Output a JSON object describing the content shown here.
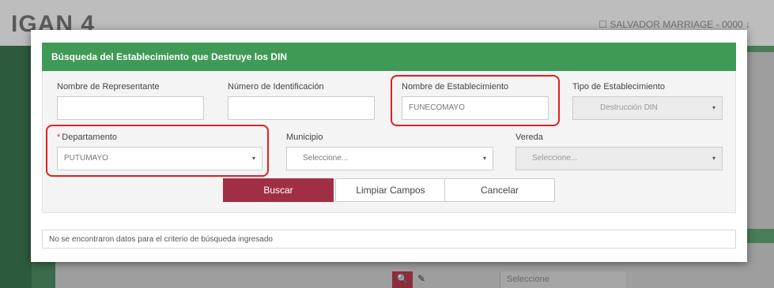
{
  "background": {
    "app_title": "IGAN 4",
    "user_text": "☐ SALVADOR MARRIAGE - 0000 ↓",
    "bottom_select_value": "Seleccione"
  },
  "modal": {
    "title": "Búsqueda del Establecimiento que Destruye los DIN",
    "fields": {
      "nombre_representante": {
        "label": "Nombre de Representante",
        "value": ""
      },
      "numero_identificacion": {
        "label": "Número de Identificación",
        "value": ""
      },
      "nombre_establecimiento": {
        "label": "Nombre de Establecimiento",
        "value": "FUNECOMAYO"
      },
      "tipo_establecimiento": {
        "label": "Tipo de Establecimiento",
        "value": "Destrucción DIN"
      },
      "departamento": {
        "label": "Departamento",
        "required_mark": "*",
        "value": "PUTUMAYO"
      },
      "municipio": {
        "label": "Municipio",
        "value": "Seleccione..."
      },
      "vereda": {
        "label": "Vereda",
        "value": "Seleccione..."
      }
    },
    "buttons": {
      "buscar": "Buscar",
      "limpiar": "Limpiar Campos",
      "cancelar": "Cancelar"
    },
    "result_message": "No se encontraron datos para el criterio de búsqueda ingresado"
  },
  "colors": {
    "header_green": "#3f9a55",
    "primary_button": "#a02f45",
    "highlight_red": "#e02020"
  },
  "icons": {
    "caret": "▾",
    "search": "search-icon",
    "brush": "brush-icon"
  }
}
